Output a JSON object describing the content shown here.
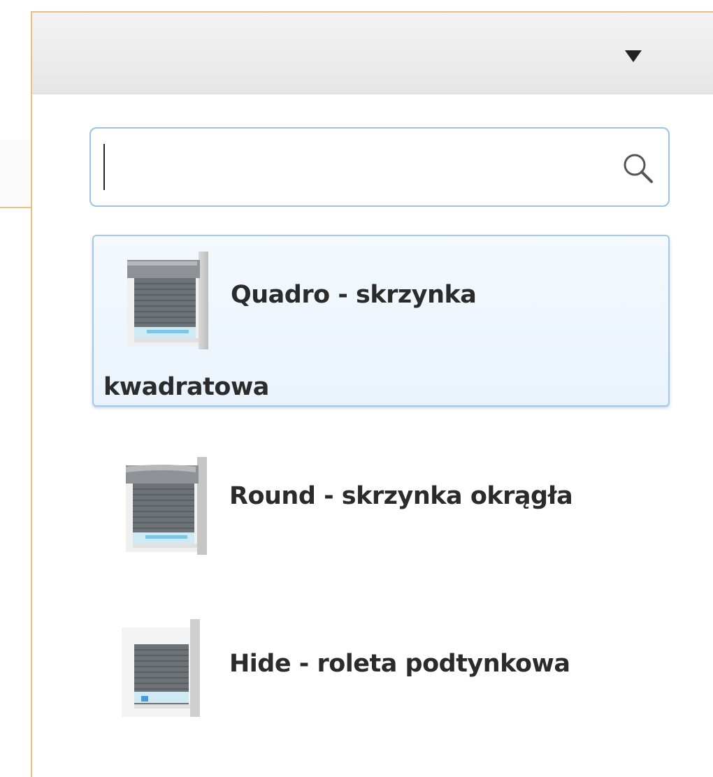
{
  "dropdown": {
    "caret_icon": "triangle-down-icon",
    "search": {
      "value": "",
      "placeholder": "",
      "icon": "search-icon"
    },
    "options": [
      {
        "label": "Quadro - skrzynka kwadratowa",
        "label_line1": "Quadro - skrzynka",
        "label_line2": "kwadratowa",
        "icon": "roller-shutter-quadro-icon",
        "selected": true
      },
      {
        "label": "Round - skrzynka okrągła",
        "icon": "roller-shutter-round-icon",
        "selected": false
      },
      {
        "label": "Hide - roleta podtynkowa",
        "icon": "roller-shutter-hide-icon",
        "selected": false
      }
    ]
  },
  "colors": {
    "panel_border": "#e8c27a",
    "focus_border": "#9cc2e6",
    "selected_bg": "#eaf3fc",
    "text": "#2b2b2b"
  }
}
